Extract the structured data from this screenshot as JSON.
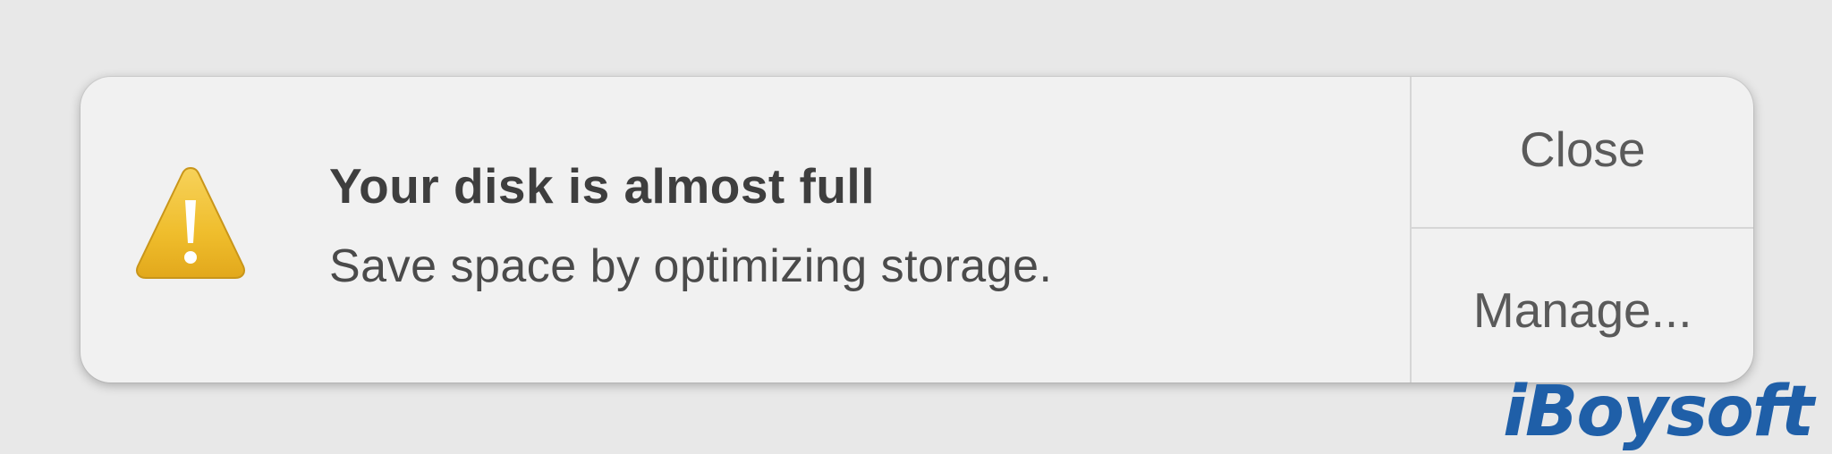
{
  "notification": {
    "title": "Your disk is almost full",
    "subtitle": "Save space by optimizing storage.",
    "icon": "warning-triangle-icon",
    "actions": {
      "close_label": "Close",
      "manage_label": "Manage..."
    }
  },
  "watermark": {
    "text": "iBoysoft"
  },
  "colors": {
    "background": "#e8e8e8",
    "panel": "#f1f1f1",
    "warning_yellow": "#f2c230",
    "watermark_blue": "#1f5fa8"
  }
}
